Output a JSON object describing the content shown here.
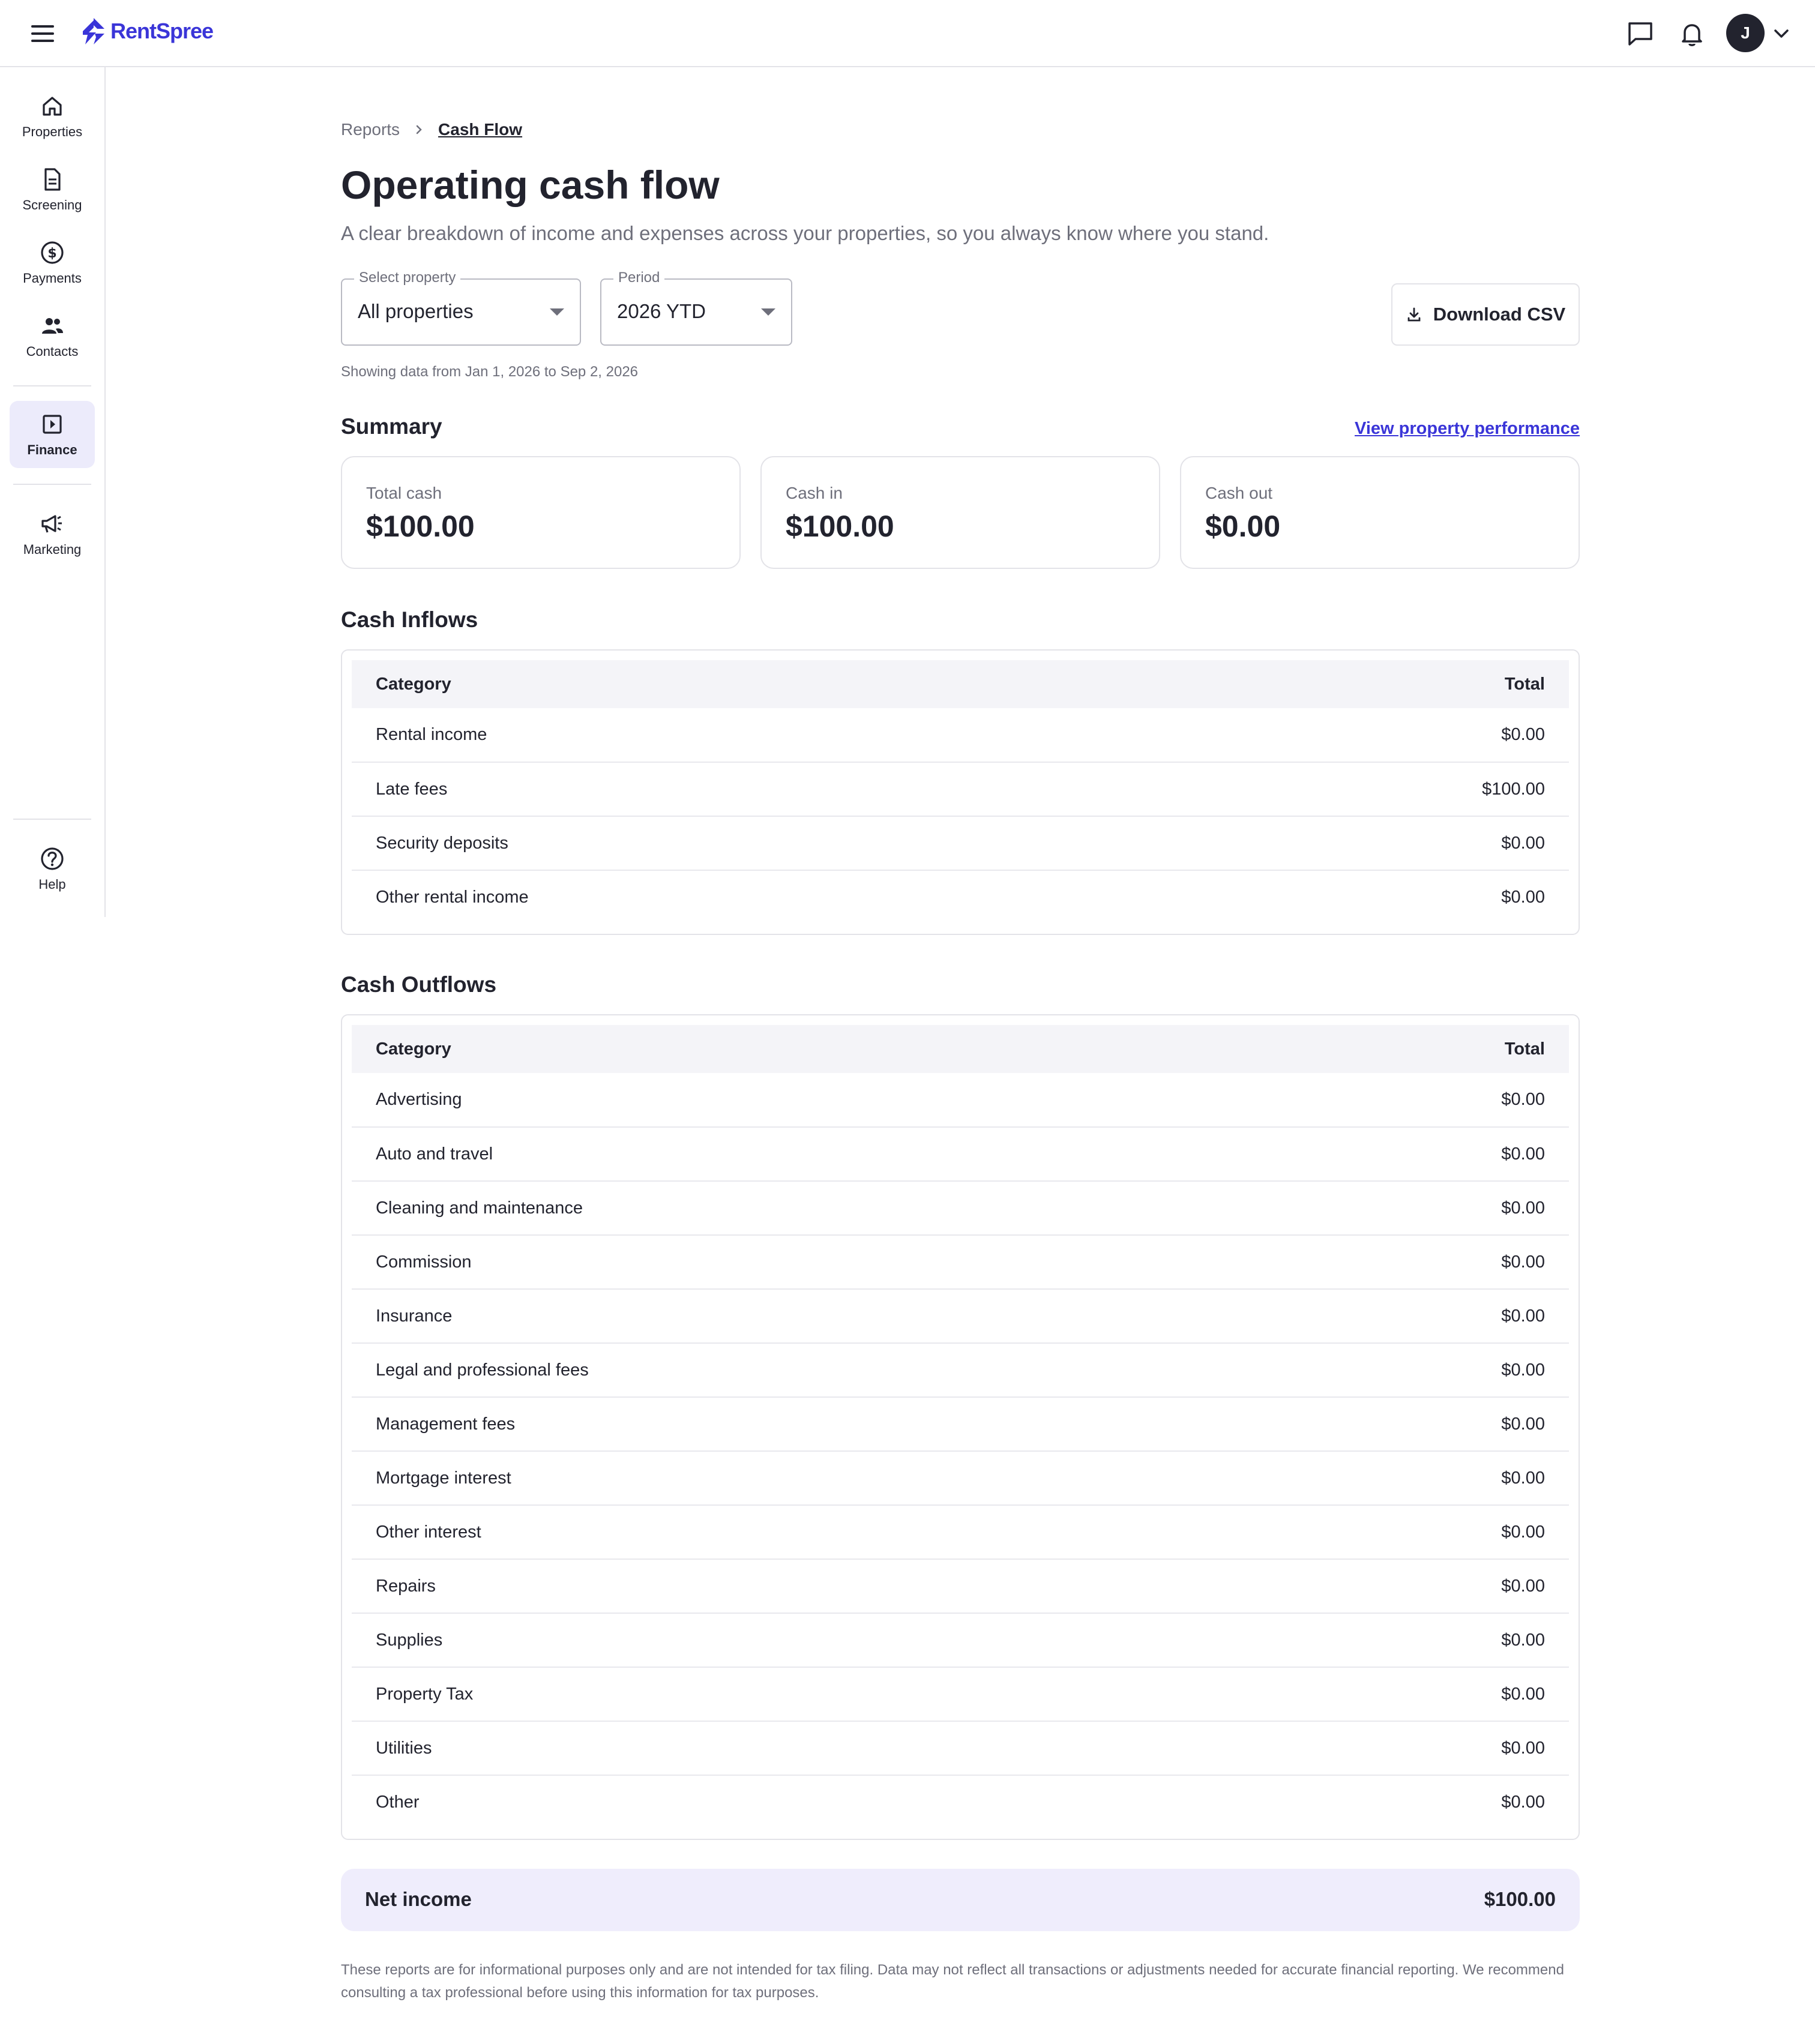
{
  "header": {
    "logo_text": "RentSpree",
    "avatar_initial": "J",
    "brand_color": "#3a35d8"
  },
  "sidebar": {
    "items": [
      {
        "label": "Properties",
        "icon": "home-icon"
      },
      {
        "label": "Screening",
        "icon": "document-icon"
      },
      {
        "label": "Payments",
        "icon": "dollar-icon"
      },
      {
        "label": "Contacts",
        "icon": "people-icon"
      },
      {
        "label": "Finance",
        "icon": "finance-icon",
        "active": true
      },
      {
        "label": "Marketing",
        "icon": "megaphone-icon"
      },
      {
        "label": "Help",
        "icon": "help-icon"
      }
    ]
  },
  "breadcrumb": {
    "parent": "Reports",
    "current": "Cash Flow"
  },
  "page": {
    "title": "Operating cash flow",
    "subtitle": "A clear breakdown of income and expenses across your properties, so you always know where you stand."
  },
  "filters": {
    "property": {
      "label": "Select property",
      "value": "All properties"
    },
    "period": {
      "label": "Period",
      "value": "2026 YTD"
    },
    "download_label": "Download CSV",
    "showing_text": "Showing data from Jan 1, 2026 to Sep 2, 2026"
  },
  "summary": {
    "heading": "Summary",
    "link_label": "View property performance",
    "cards": [
      {
        "label": "Total cash",
        "value": "$100.00"
      },
      {
        "label": "Cash in",
        "value": "$100.00"
      },
      {
        "label": "Cash out",
        "value": "$0.00"
      }
    ]
  },
  "inflows": {
    "heading": "Cash Inflows",
    "columns": [
      "Category",
      "Total"
    ],
    "rows": [
      {
        "category": "Rental income",
        "total": "$0.00"
      },
      {
        "category": "Late fees",
        "total": "$100.00"
      },
      {
        "category": "Security deposits",
        "total": "$0.00"
      },
      {
        "category": "Other rental income",
        "total": "$0.00"
      }
    ]
  },
  "outflows": {
    "heading": "Cash Outflows",
    "columns": [
      "Category",
      "Total"
    ],
    "rows": [
      {
        "category": "Advertising",
        "total": "$0.00"
      },
      {
        "category": "Auto and travel",
        "total": "$0.00"
      },
      {
        "category": "Cleaning and maintenance",
        "total": "$0.00"
      },
      {
        "category": "Commission",
        "total": "$0.00"
      },
      {
        "category": "Insurance",
        "total": "$0.00"
      },
      {
        "category": "Legal and professional fees",
        "total": "$0.00"
      },
      {
        "category": "Management fees",
        "total": "$0.00"
      },
      {
        "category": "Mortgage interest",
        "total": "$0.00"
      },
      {
        "category": "Other interest",
        "total": "$0.00"
      },
      {
        "category": "Repairs",
        "total": "$0.00"
      },
      {
        "category": "Supplies",
        "total": "$0.00"
      },
      {
        "category": "Property Tax",
        "total": "$0.00"
      },
      {
        "category": "Utilities",
        "total": "$0.00"
      },
      {
        "category": "Other",
        "total": "$0.00"
      }
    ]
  },
  "net_income": {
    "label": "Net income",
    "value": "$100.00"
  },
  "disclaimer": "These reports are for informational purposes only and are not intended for tax filing. Data may not reflect all transactions or adjustments needed for accurate financial reporting. We recommend consulting a tax professional before using this information for tax purposes."
}
